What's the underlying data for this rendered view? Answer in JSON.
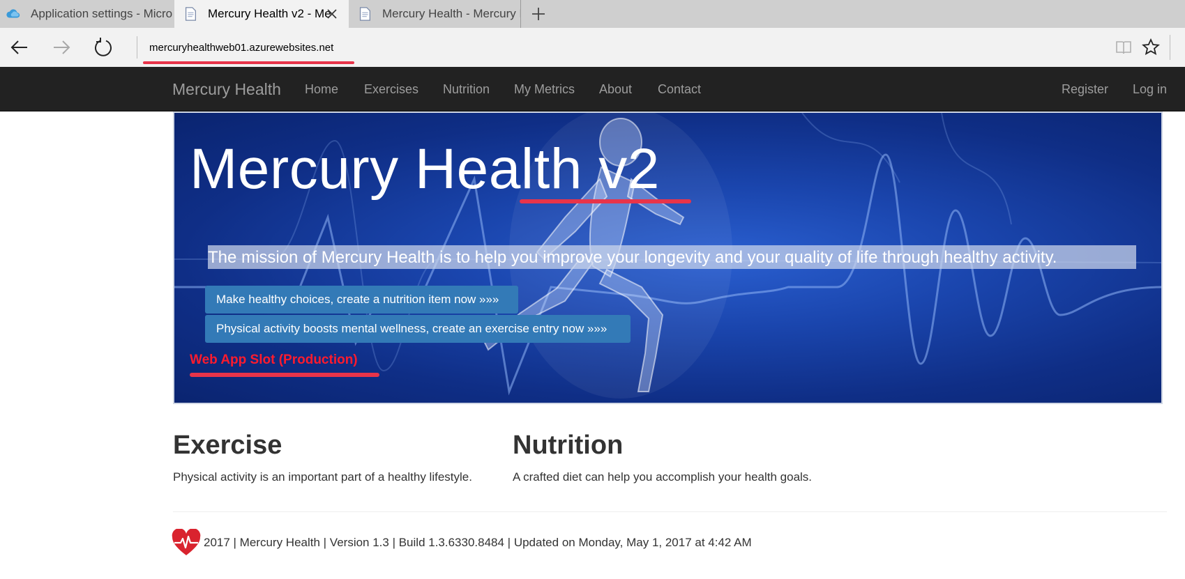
{
  "browser": {
    "tabs": [
      {
        "label": "Application settings - Micro",
        "icon": "azure-cloud-icon"
      },
      {
        "label": "Mercury Health v2 - Me",
        "icon": "page-icon",
        "active": true
      },
      {
        "label": "Mercury Health - Mercury H",
        "icon": "page-icon"
      }
    ],
    "url": "mercuryhealthweb01.azurewebsites.net"
  },
  "navbar": {
    "brand": "Mercury Health",
    "links": [
      "Home",
      "Exercises",
      "Nutrition",
      "My Metrics",
      "About",
      "Contact"
    ],
    "right_links": [
      "Register",
      "Log in"
    ]
  },
  "hero": {
    "title": "Mercury Health v2",
    "mission": "The mission of Mercury Health is to help you improve your longevity and your quality of life through healthy activity.",
    "buttons": [
      "Make healthy choices, create a nutrition item now »»»",
      "Physical activity boosts mental wellness, create an exercise entry now »»»"
    ],
    "slot_label": "Web App Slot (Production)"
  },
  "columns": [
    {
      "heading": "Exercise",
      "text": "Physical activity is an important part of a healthy lifestyle."
    },
    {
      "heading": "Nutrition",
      "text": "A crafted diet can help you accomplish your health goals."
    }
  ],
  "footer": {
    "text": "2017 | Mercury Health | Version 1.3 | Build 1.3.6330.8484 | Updated on Monday, May 1, 2017 at 4:42 AM",
    "icon": "heart-pulse-icon"
  },
  "colors": {
    "navbar_bg": "#222222",
    "button_blue": "#337ab7",
    "annotation_red": "#e8344a"
  }
}
